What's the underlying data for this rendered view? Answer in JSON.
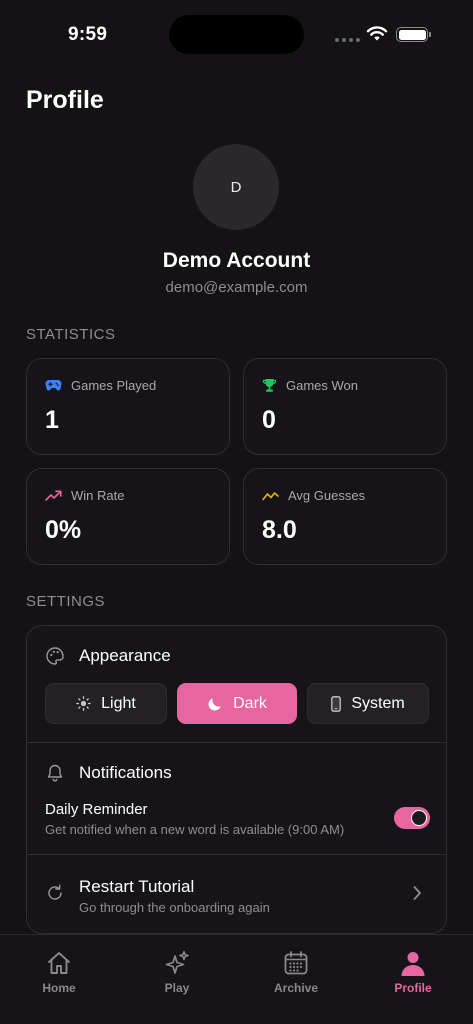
{
  "status_bar": {
    "time": "9:59"
  },
  "header": {
    "title": "Profile"
  },
  "profile": {
    "avatar_initial": "D",
    "name": "Demo Account",
    "email": "demo@example.com"
  },
  "statistics": {
    "section_label": "STATISTICS",
    "cards": [
      {
        "label": "Games Played",
        "value": "1",
        "icon": "gamepad-icon",
        "color": "#3b82f6"
      },
      {
        "label": "Games Won",
        "value": "0",
        "icon": "trophy-icon",
        "color": "#22c55e"
      },
      {
        "label": "Win Rate",
        "value": "0%",
        "icon": "trending-up-icon",
        "color": "#e8669f"
      },
      {
        "label": "Avg Guesses",
        "value": "8.0",
        "icon": "chart-line-icon",
        "color": "#eab308"
      }
    ]
  },
  "settings": {
    "section_label": "SETTINGS",
    "appearance": {
      "title": "Appearance",
      "options": [
        {
          "label": "Light",
          "icon": "sun-icon"
        },
        {
          "label": "Dark",
          "icon": "moon-icon"
        },
        {
          "label": "System",
          "icon": "phone-icon"
        }
      ],
      "selected": "Dark"
    },
    "notifications": {
      "title": "Notifications",
      "reminder_title": "Daily Reminder",
      "reminder_subtitle": "Get notified when a new word is available (9:00 AM)",
      "reminder_enabled": true
    },
    "tutorial": {
      "title": "Restart Tutorial",
      "subtitle": "Go through the onboarding again"
    }
  },
  "tabbar": {
    "tabs": [
      {
        "label": "Home",
        "icon": "home-icon"
      },
      {
        "label": "Play",
        "icon": "sparkles-icon"
      },
      {
        "label": "Archive",
        "icon": "calendar-icon"
      },
      {
        "label": "Profile",
        "icon": "person-icon"
      }
    ],
    "active": "Profile"
  },
  "colors": {
    "accent": "#e8669f",
    "background": "#141215",
    "card": "#161418"
  }
}
